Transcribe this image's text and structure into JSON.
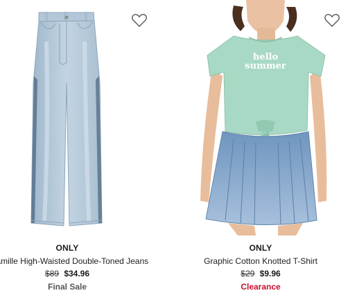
{
  "products": [
    {
      "brand": "ONLY",
      "title": "Camille High-Waisted Double-Toned Jeans",
      "original_price": "$89",
      "sale_price": "$34.96",
      "badge": "Final Sale",
      "badge_color": "#555555",
      "wishlist_icon": "heart-outline-icon"
    },
    {
      "brand": "ONLY",
      "title": "Graphic Cotton Knotted T-Shirt",
      "original_price": "$29",
      "sale_price": "$9.96",
      "badge": "Clearance",
      "badge_color": "#c8102e",
      "wishlist_icon": "heart-outline-icon",
      "shirt_print": "hello summer"
    }
  ]
}
